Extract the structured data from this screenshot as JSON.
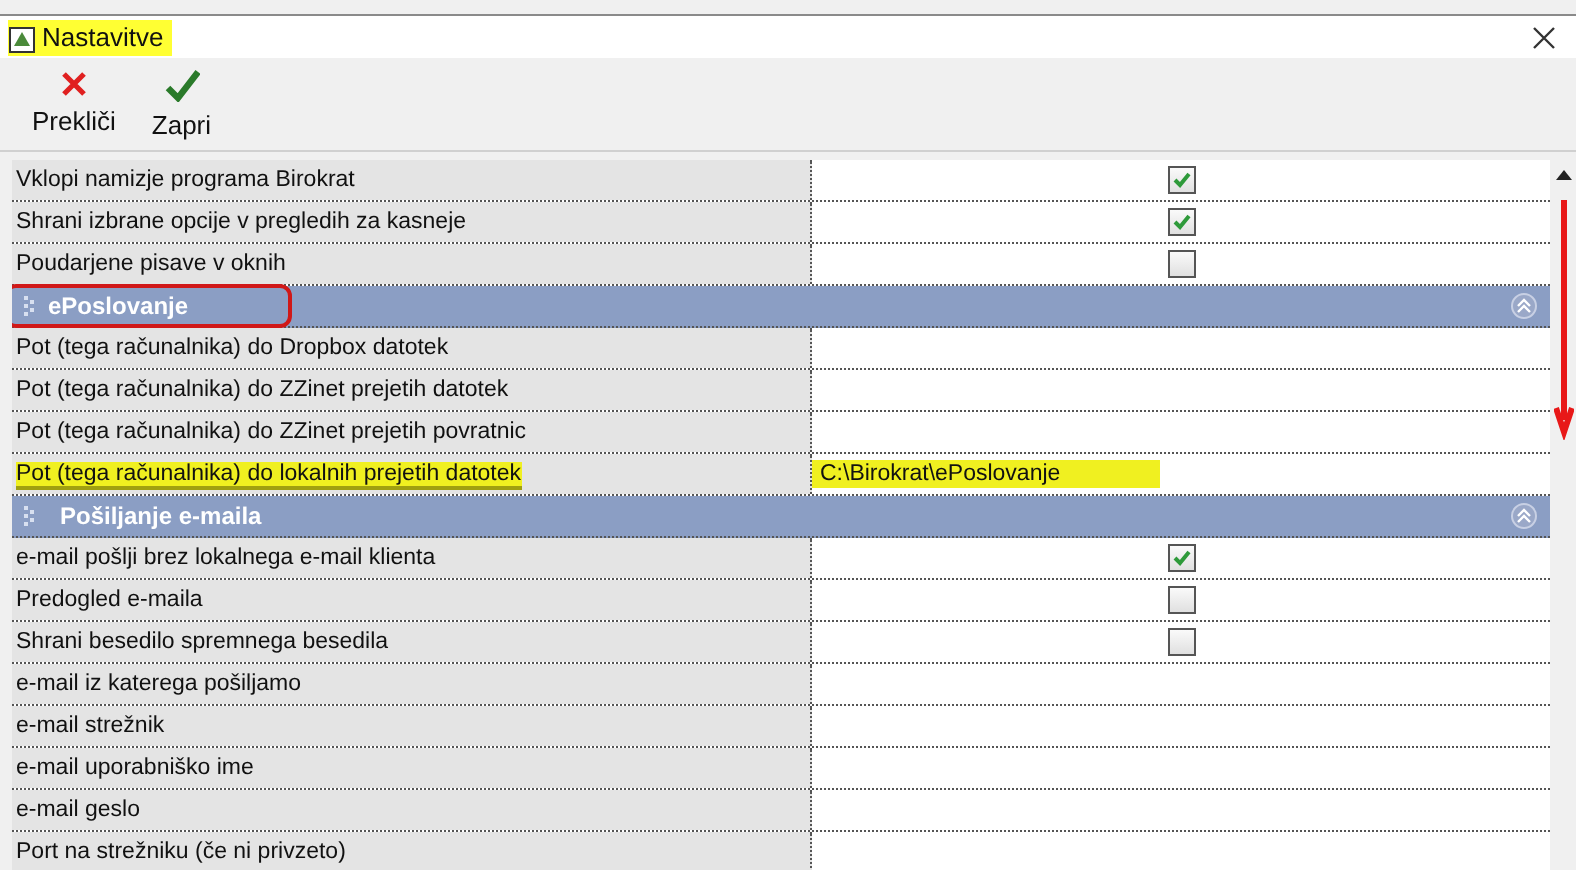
{
  "window": {
    "title": "Nastavitve",
    "title_highlighted": true
  },
  "toolbar": [
    {
      "kind": "cancel",
      "label": "Prekliči"
    },
    {
      "kind": "ok",
      "label": "Zapri"
    }
  ],
  "sections": [
    {
      "rows": [
        {
          "label": "Vklopi namizje programa Birokrat",
          "kind": "check",
          "checked": true,
          "highlighted": false
        },
        {
          "label": "Shrani izbrane opcije v pregledih za kasneje",
          "kind": "check",
          "checked": true,
          "highlighted": false
        },
        {
          "label": "Poudarjene pisave v oknih",
          "kind": "check",
          "checked": false,
          "highlighted": false
        }
      ]
    },
    {
      "title": "ePoslovanje",
      "circled": true,
      "rows": [
        {
          "label": "Pot (tega računalnika) do Dropbox datotek",
          "kind": "text",
          "highlighted": false
        },
        {
          "label": "Pot (tega računalnika) do ZZinet prejetih datotek",
          "kind": "text",
          "highlighted": false
        },
        {
          "label": "Pot (tega računalnika) do ZZinet prejetih povratnic",
          "kind": "text",
          "highlighted": false
        },
        {
          "label": "Pot (tega računalnika) do lokalnih prejetih datotek",
          "kind": "text",
          "value": "C:\\Birokrat\\ePoslovanje",
          "highlighted": true
        }
      ]
    },
    {
      "title": "Pošiljanje e-maila",
      "circled": false,
      "rows": [
        {
          "label": "e-mail pošlji brez lokalnega e-mail klienta",
          "kind": "check",
          "checked": true,
          "highlighted": false
        },
        {
          "label": "Predogled e-maila",
          "kind": "check",
          "checked": false,
          "highlighted": false
        },
        {
          "label": "Shrani besedilo spremnega besedila",
          "kind": "check",
          "checked": false,
          "highlighted": false
        },
        {
          "label": "e-mail iz katerega pošiljamo",
          "kind": "text",
          "highlighted": false
        },
        {
          "label": "e-mail strežnik",
          "kind": "text",
          "highlighted": false
        },
        {
          "label": "e-mail uporabniško ime",
          "kind": "text",
          "highlighted": false
        },
        {
          "label": "e-mail geslo",
          "kind": "text",
          "highlighted": false
        },
        {
          "label": "Port na strežniku (če ni privzeto)",
          "kind": "text",
          "highlighted": false
        }
      ]
    }
  ]
}
